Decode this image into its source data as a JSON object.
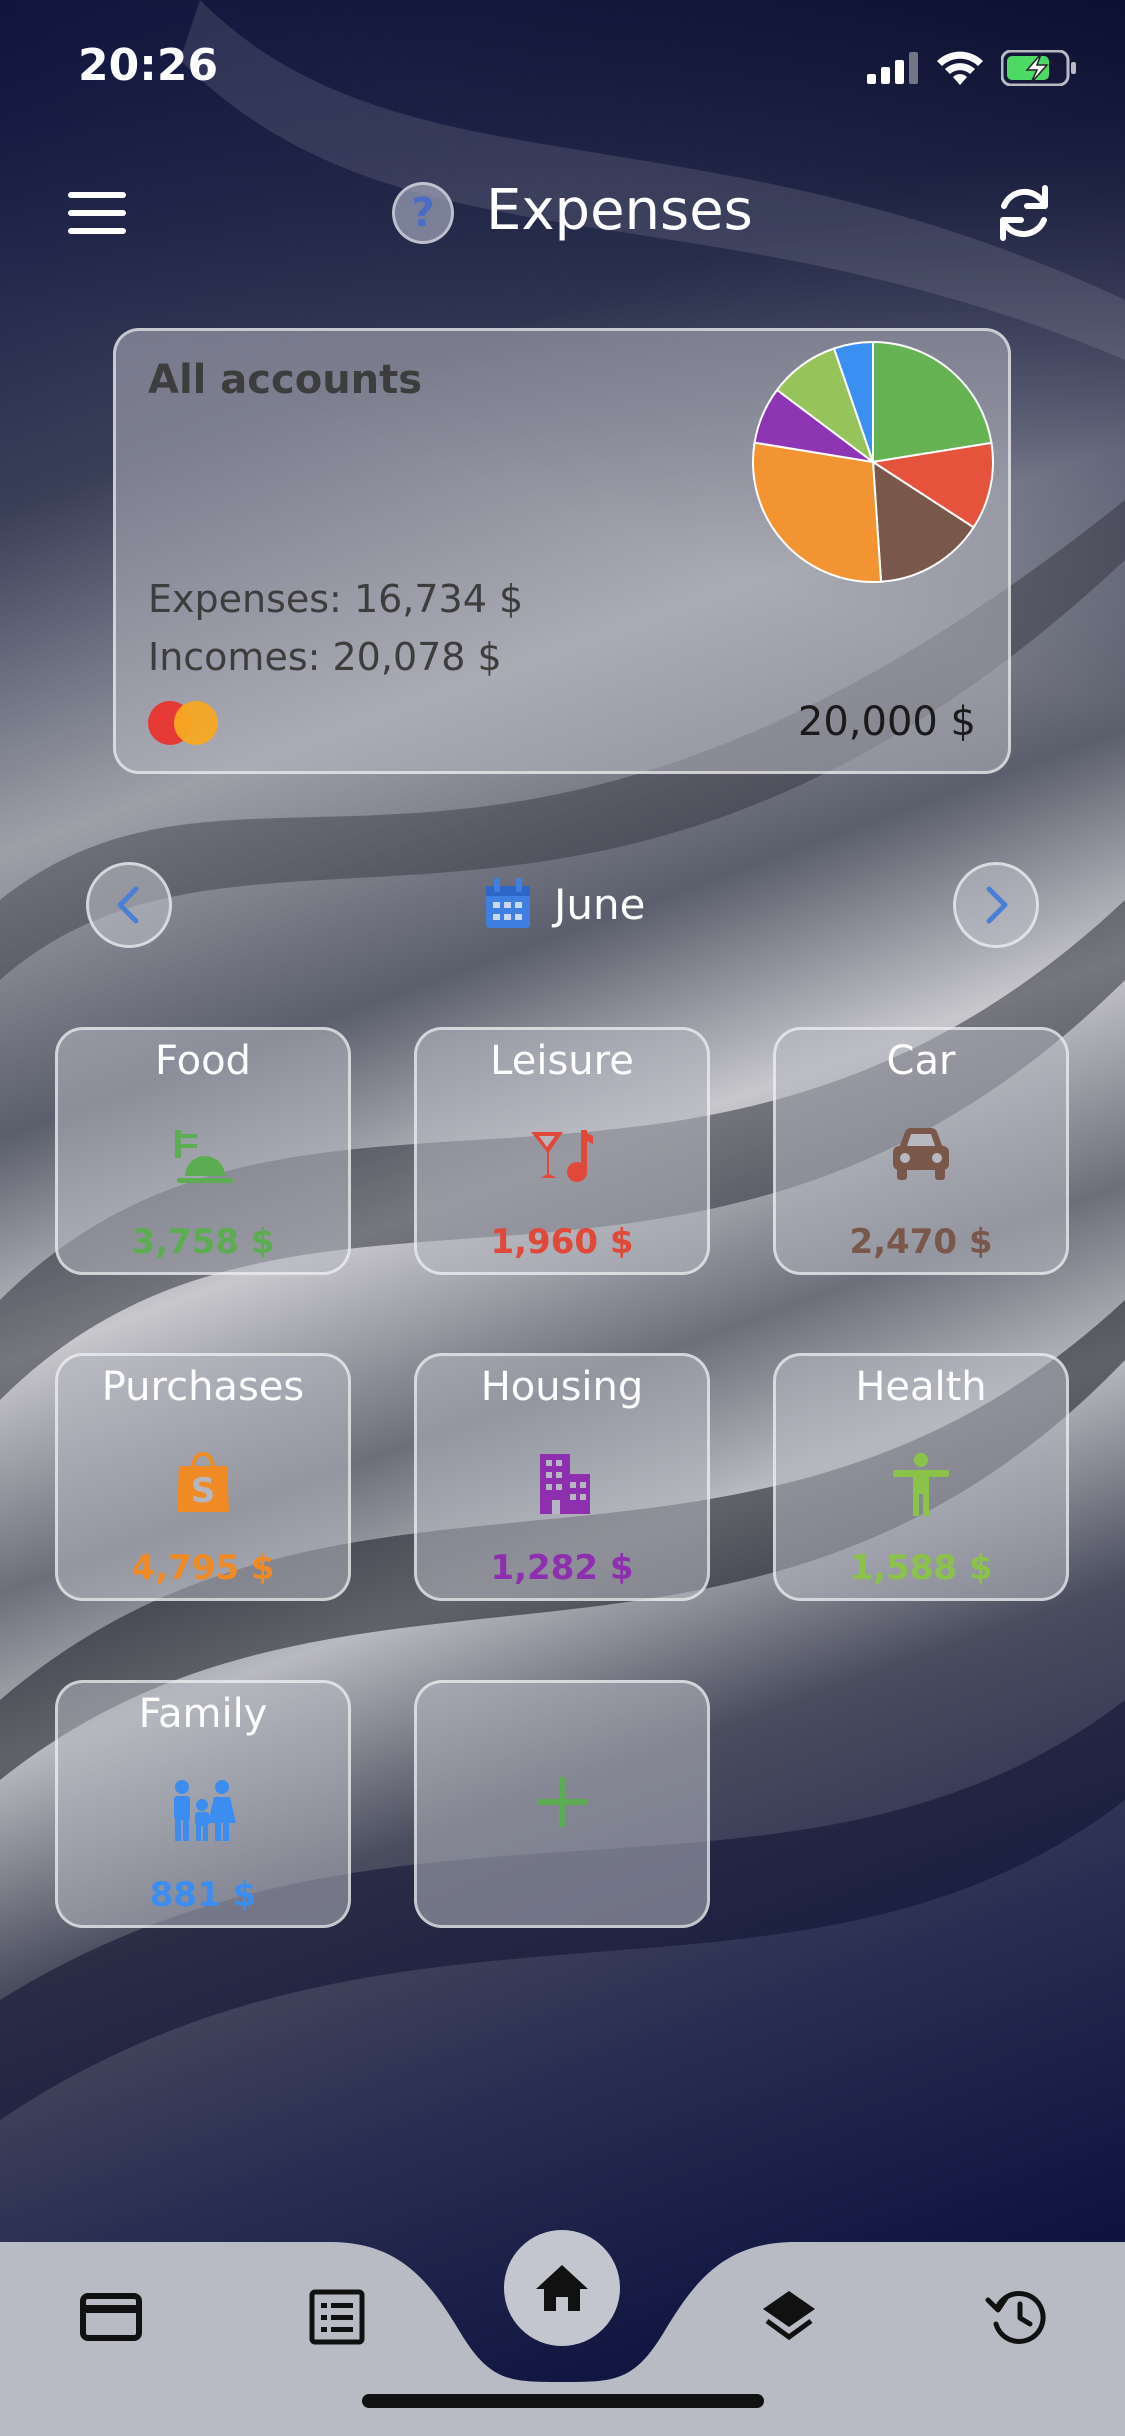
{
  "status": {
    "time": "20:26"
  },
  "header": {
    "title": "Expenses",
    "help": "?"
  },
  "account": {
    "name": "All accounts",
    "expenses": "Expenses: 16,734 $",
    "incomes": "Incomes: 20,078 $",
    "balance": "20,000 $",
    "card_icon": "mastercard-icon"
  },
  "month": {
    "label": "June"
  },
  "categories": [
    {
      "name": "Food",
      "amount": "3,758 $",
      "color": "#5cad52",
      "icon": "food-icon"
    },
    {
      "name": "Leisure",
      "amount": "1,960 $",
      "color": "#e0483a",
      "icon": "cocktail-music-icon"
    },
    {
      "name": "Car",
      "amount": "2,470 $",
      "color": "#7a574b",
      "icon": "car-icon"
    },
    {
      "name": "Purchases",
      "amount": "4,795 $",
      "color": "#f08a24",
      "icon": "shopping-bag-icon"
    },
    {
      "name": "Housing",
      "amount": "1,282 $",
      "color": "#8e2fb0",
      "icon": "building-icon"
    },
    {
      "name": "Health",
      "amount": "1,588 $",
      "color": "#8bc34a",
      "icon": "person-icon"
    },
    {
      "name": "Family",
      "amount": "881 $",
      "color": "#3b8ef0",
      "icon": "family-icon"
    }
  ],
  "add_tile": {
    "icon": "plus-icon",
    "color": "#5cad52"
  },
  "tabs": [
    "card-icon",
    "list-icon",
    "home-icon",
    "layers-icon",
    "history-icon"
  ],
  "pie": {
    "slices": [
      {
        "value": 3758,
        "color": "#66b354"
      },
      {
        "value": 1960,
        "color": "#e5533d"
      },
      {
        "value": 2470,
        "color": "#7a574b"
      },
      {
        "value": 4795,
        "color": "#f39433"
      },
      {
        "value": 1282,
        "color": "#8e35b3"
      },
      {
        "value": 1588,
        "color": "#97c45a"
      },
      {
        "value": 881,
        "color": "#3c8ff2"
      }
    ]
  }
}
